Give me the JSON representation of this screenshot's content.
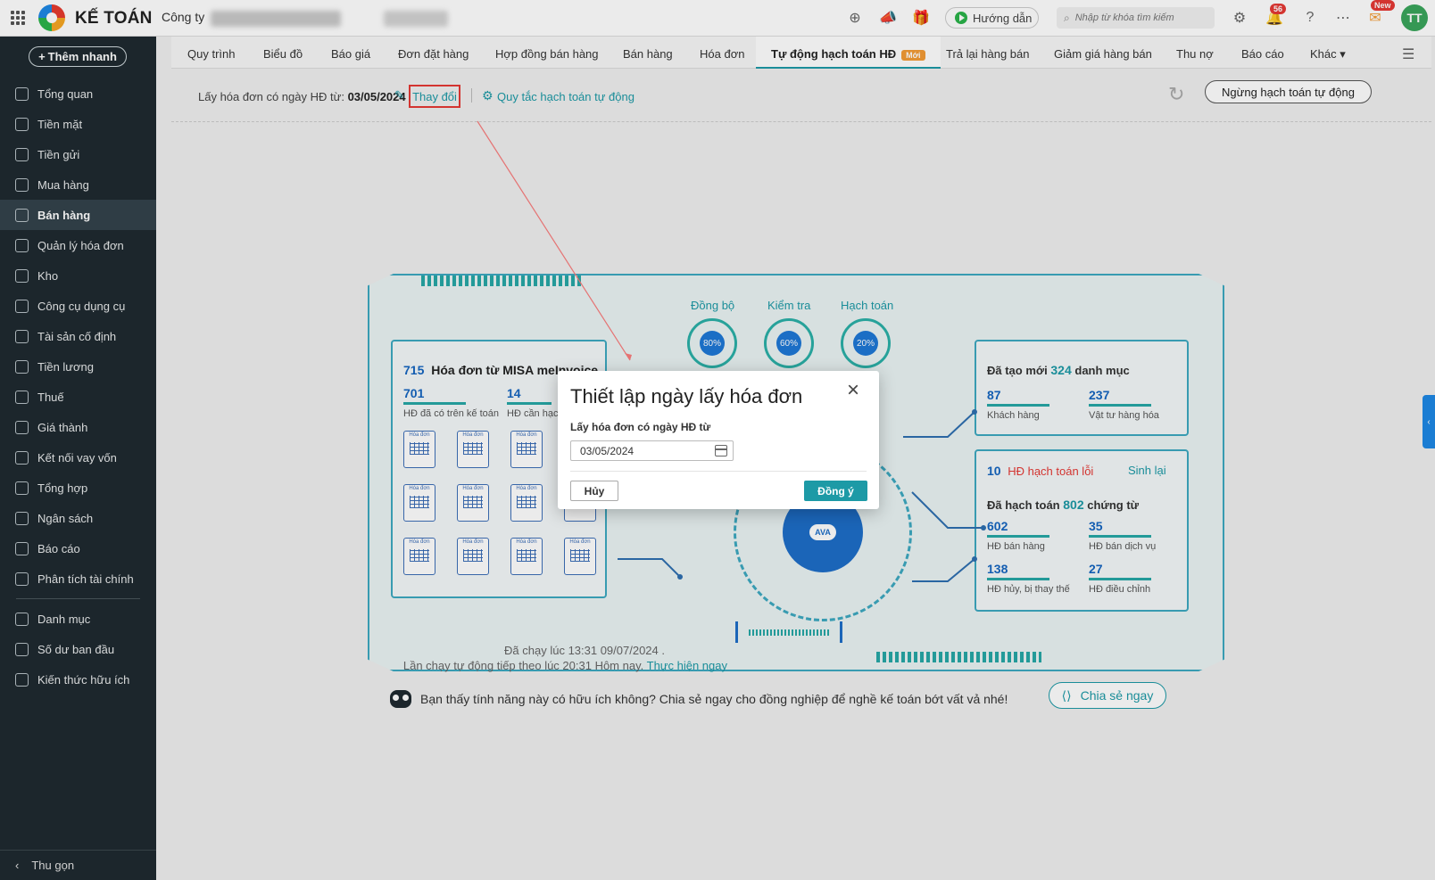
{
  "topbar": {
    "brand": "KẾ TOÁN",
    "company_label": "Công ty",
    "guide_label": "Hướng dẫn",
    "search_placeholder": "Nhập từ khóa tìm kiếm",
    "notif_count": "56",
    "new_badge": "New",
    "avatar_initials": "TT"
  },
  "sidebar": {
    "add_button": "Thêm nhanh",
    "items": [
      {
        "label": "Tổng quan",
        "icon": "dashboard-icon"
      },
      {
        "label": "Tiền mặt",
        "icon": "cash-icon"
      },
      {
        "label": "Tiền gửi",
        "icon": "bank-icon"
      },
      {
        "label": "Mua hàng",
        "icon": "bag-icon"
      },
      {
        "label": "Bán hàng",
        "icon": "cart-icon",
        "active": true
      },
      {
        "label": "Quản lý hóa đơn",
        "icon": "invoice-icon"
      },
      {
        "label": "Kho",
        "icon": "warehouse-icon"
      },
      {
        "label": "Công cụ dụng cụ",
        "icon": "tools-icon"
      },
      {
        "label": "Tài sản cố định",
        "icon": "asset-icon"
      },
      {
        "label": "Tiền lương",
        "icon": "salary-icon"
      },
      {
        "label": "Thuế",
        "icon": "tax-icon"
      },
      {
        "label": "Giá thành",
        "icon": "price-tag-icon"
      },
      {
        "label": "Kết nối vay vốn",
        "icon": "loan-icon"
      },
      {
        "label": "Tổng hợp",
        "icon": "summary-icon"
      },
      {
        "label": "Ngân sách",
        "icon": "budget-icon"
      },
      {
        "label": "Báo cáo",
        "icon": "report-icon"
      },
      {
        "label": "Phân tích tài chính",
        "icon": "analytics-icon"
      }
    ],
    "items2": [
      {
        "label": "Danh mục",
        "icon": "list-icon"
      },
      {
        "label": "Số dư ban đầu",
        "icon": "balance-icon"
      },
      {
        "label": "Kiến thức hữu ích",
        "icon": "knowledge-icon"
      }
    ],
    "collapse_label": "Thu gọn"
  },
  "tabs": [
    {
      "label": "Quy trình"
    },
    {
      "label": "Biểu đồ"
    },
    {
      "label": "Báo giá"
    },
    {
      "label": "Đơn đặt hàng"
    },
    {
      "label": "Hợp đồng bán hàng"
    },
    {
      "label": "Bán hàng"
    },
    {
      "label": "Hóa đơn"
    },
    {
      "label": "Tự động hạch toán HĐ",
      "active": true,
      "badge": "Mới"
    },
    {
      "label": "Trả lại hàng bán"
    },
    {
      "label": "Giảm giá hàng bán"
    },
    {
      "label": "Thu nợ"
    },
    {
      "label": "Báo cáo"
    },
    {
      "label": "Khác"
    }
  ],
  "toolbar": {
    "filter_prefix": "Lấy hóa đơn có ngày HĐ từ:",
    "filter_date": "03/05/2024",
    "change_link": "Thay đổi",
    "rule_link": "Quy tắc hạch toán tự động",
    "stop_button": "Ngừng hạch toán tự động"
  },
  "dashboard": {
    "gauges": [
      {
        "label": "Đồng bộ",
        "percent": "80%"
      },
      {
        "label": "Kiểm tra",
        "percent": "60%"
      },
      {
        "label": "Hạch toán",
        "percent": "20%"
      }
    ],
    "left_card": {
      "count": "715",
      "title": "Hóa đơn từ MISA meInvoice",
      "stat1_value": "701",
      "stat1_label": "HĐ đã có trên kế toán",
      "stat2_value": "14",
      "stat2_label": "HĐ cần hạch toán",
      "doc_icon_label": "Hóa đơn"
    },
    "right_top": {
      "prefix": "Đã tạo mới",
      "count": "324",
      "suffix": "danh mục",
      "stat1_value": "87",
      "stat1_label": "Khách hàng",
      "stat2_value": "237",
      "stat2_label": "Vật tư hàng hóa"
    },
    "right_bottom": {
      "error_count": "10",
      "error_label": "HĐ hạch toán lỗi",
      "regen_link": "Sinh lại",
      "posted_prefix": "Đã hạch toán",
      "posted_count": "802",
      "posted_suffix": "chứng từ",
      "s1_value": "602",
      "s1_label": "HĐ bán hàng",
      "s2_value": "35",
      "s2_label": "HĐ bán dịch vụ",
      "s3_value": "138",
      "s3_label": "HĐ hủy, bị thay thế",
      "s4_value": "27",
      "s4_label": "HĐ điều chỉnh"
    },
    "last_run": "Đã chạy lúc 13:31 09/07/2024 .",
    "next_run": "Lần chạy tự động tiếp theo lúc 20:31 Hôm nay.",
    "run_now": "Thực hiện ngay",
    "core_label": "AVA"
  },
  "share": {
    "text": "Bạn thấy tính năng này có hữu ích không? Chia sẻ ngay cho đồng nghiệp để nghề kế toán bớt vất vả nhé!",
    "button": "Chia sẻ ngay"
  },
  "dialog": {
    "title": "Thiết lập ngày lấy hóa đơn",
    "field_label": "Lấy hóa đơn có ngày HĐ từ",
    "field_value": "03/05/2024",
    "cancel": "Hủy",
    "ok": "Đồng ý"
  }
}
